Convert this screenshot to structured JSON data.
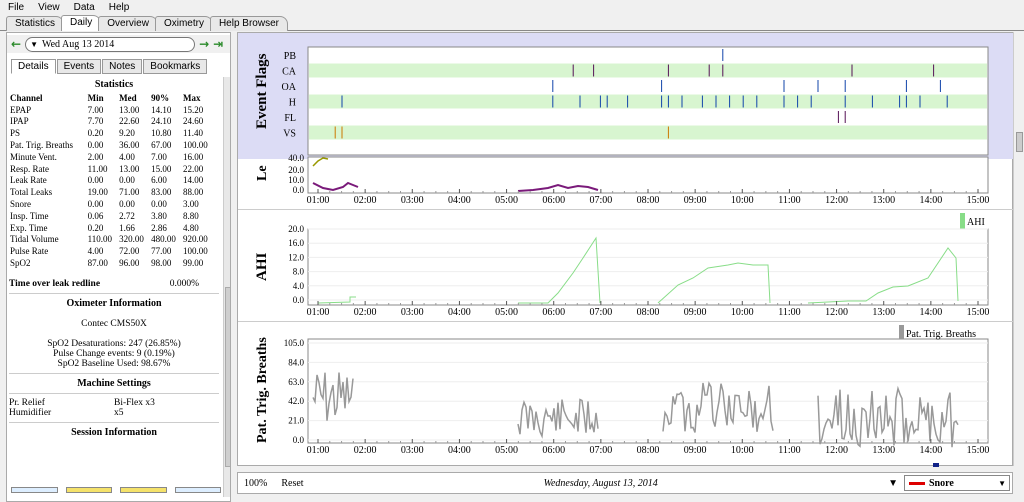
{
  "menu": [
    "File",
    "View",
    "Data",
    "Help"
  ],
  "tabs": [
    "Statistics",
    "Daily",
    "Overview",
    "Oximetry",
    "Help Browser"
  ],
  "active_tab": 1,
  "date_label": "Wed Aug 13 2014",
  "subtabs": [
    "Details",
    "Events",
    "Notes",
    "Bookmarks"
  ],
  "stats": {
    "title": "Statistics",
    "headers": [
      "Channel",
      "Min",
      "Med",
      "90%",
      "Max"
    ],
    "rows": [
      [
        "EPAP",
        "7.00",
        "13.00",
        "14.10",
        "15.20"
      ],
      [
        "IPAP",
        "7.70",
        "22.60",
        "24.10",
        "24.60"
      ],
      [
        "PS",
        "0.20",
        "9.20",
        "10.80",
        "11.40"
      ],
      [
        "Pat. Trig. Breaths",
        "0.00",
        "36.00",
        "67.00",
        "100.00"
      ],
      [
        "Minute Vent.",
        "2.00",
        "4.00",
        "7.00",
        "16.00"
      ],
      [
        "Resp. Rate",
        "11.00",
        "13.00",
        "15.00",
        "22.00"
      ],
      [
        "Leak Rate",
        "0.00",
        "0.00",
        "6.00",
        "14.00"
      ],
      [
        "Total Leaks",
        "19.00",
        "71.00",
        "83.00",
        "88.00"
      ],
      [
        "Snore",
        "0.00",
        "0.00",
        "0.00",
        "3.00"
      ],
      [
        "Insp. Time",
        "0.06",
        "2.72",
        "3.80",
        "8.80"
      ],
      [
        "Exp. Time",
        "0.20",
        "1.66",
        "2.86",
        "4.80"
      ],
      [
        "Tidal Volume",
        "110.00",
        "320.00",
        "480.00",
        "920.00"
      ],
      [
        "Pulse Rate",
        "4.00",
        "72.00",
        "77.00",
        "100.00"
      ],
      [
        "SpO2",
        "87.00",
        "96.00",
        "98.00",
        "99.00"
      ]
    ],
    "leak_label": "Time over leak redline",
    "leak_value": "0.000%"
  },
  "oximeter": {
    "title": "Oximeter Information",
    "device": "Contec CMS50X",
    "line1": "SpO2 Desaturations: 247 (26.85%)",
    "line2": "Pulse Change events: 9 (0.19%)",
    "line3": "SpO2 Baseline Used: 98.67%"
  },
  "machine": {
    "title": "Machine Settings",
    "r1_label": "Pr. Relief",
    "r1_value": "Bi-Flex x3",
    "r2_label": "Humidifier",
    "r2_value": "x5"
  },
  "session_title": "Session Information",
  "time_ticks": [
    "01:00",
    "02:00",
    "03:00",
    "04:00",
    "05:00",
    "06:00",
    "07:00",
    "08:00",
    "09:00",
    "10:00",
    "11:00",
    "12:00",
    "13:00",
    "14:00",
    "15:00"
  ],
  "flags_panel": {
    "title": "Event Flags",
    "rows": [
      "PB",
      "CA",
      "OA",
      "H",
      "FL",
      "VS"
    ]
  },
  "leak_panel": {
    "title": "Le",
    "yticks": [
      "40.0",
      "20.0",
      "10.0",
      "0.0"
    ]
  },
  "ahi_panel": {
    "title": "AHI",
    "legend": "AHI",
    "yticks": [
      "20.0",
      "16.0",
      "12.0",
      "8.0",
      "4.0",
      "0.0"
    ]
  },
  "ptb_panel": {
    "title": "Pat. Trig. Breaths",
    "legend": "Pat. Trig. Breaths",
    "yticks": [
      "105.0",
      "84.0",
      "63.0",
      "42.0",
      "21.0",
      "0.0"
    ]
  },
  "status": {
    "zoom": "100%",
    "reset": "Reset",
    "date": "Wednesday, August 13, 2014",
    "select": "Snore"
  },
  "colors": {
    "flag_stripe": "#d8f5d0",
    "ahi": "#88dd88",
    "ptb": "#999999",
    "leak_purple": "#7a1a7a",
    "leak_olive": "#999900",
    "flags_bg": "#dcdcf5"
  }
}
